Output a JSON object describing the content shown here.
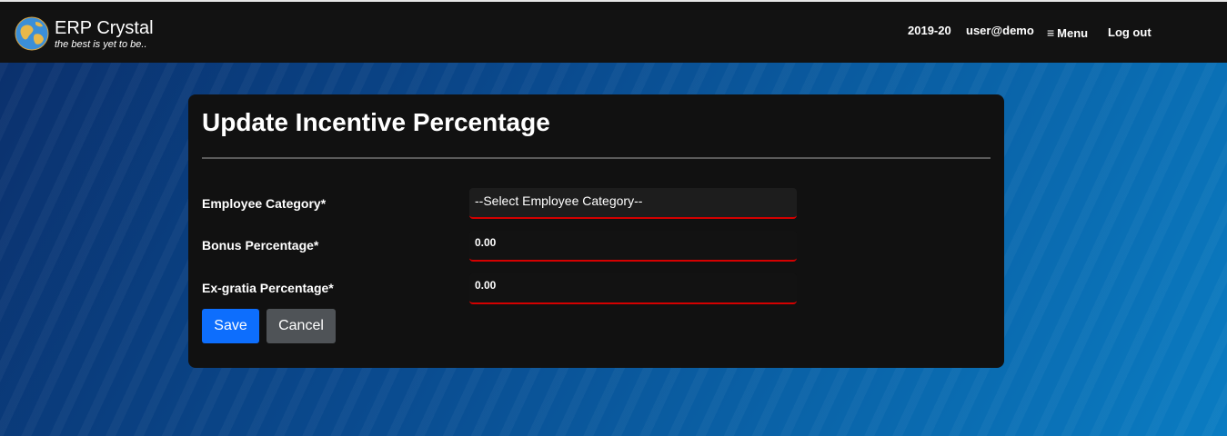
{
  "header": {
    "brand_title": "ERP Crystal",
    "brand_tagline": "the best is yet to be..",
    "logo_icon": "globe-icon",
    "year": "2019-20",
    "user": "user@demo",
    "menu_label": "Menu",
    "menu_icon": "hamburger-icon",
    "logout_label": "Log out"
  },
  "form": {
    "title": "Update Incentive Percentage",
    "fields": {
      "employee_category": {
        "label": "Employee Category*",
        "selected": "--Select Employee Category--"
      },
      "bonus_percentage": {
        "label": "Bonus Percentage*",
        "value": "0.00"
      },
      "exgratia_percentage": {
        "label": "Ex-gratia Percentage*",
        "value": "0.00"
      }
    },
    "save_label": "Save",
    "cancel_label": "Cancel"
  },
  "colors": {
    "primary_button": "#0d6efd",
    "secondary_button": "#4f5357",
    "required_underline": "#d40000",
    "card_background": "#111111",
    "header_background": "#121212"
  }
}
